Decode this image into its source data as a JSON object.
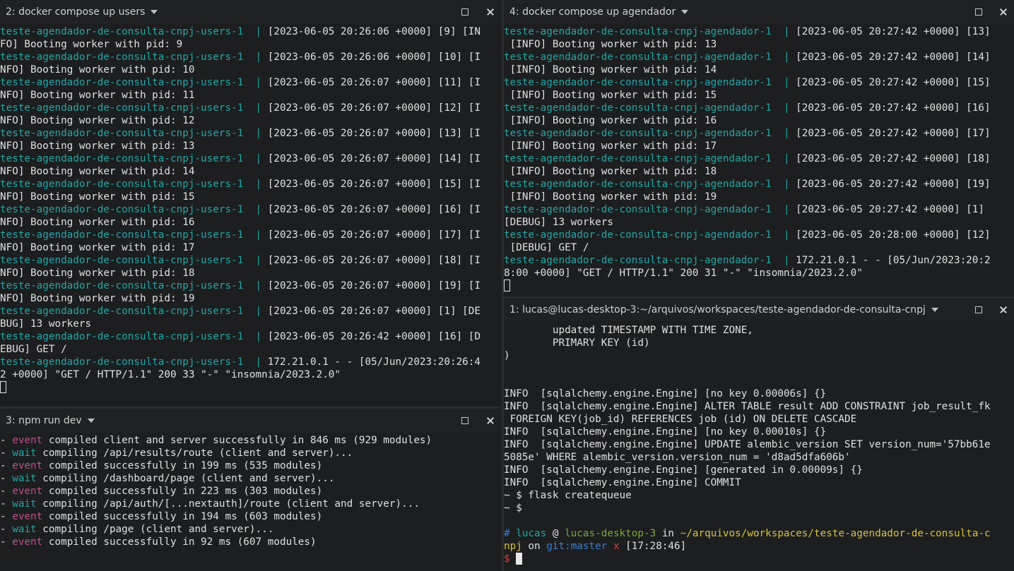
{
  "pane_users": {
    "title": "2: docker compose up users",
    "lines": [
      [
        {
          "t": "teste-agendador-de-consulta-cnpj-users-1  ",
          "c": "teal"
        },
        {
          "t": "| ",
          "c": "teal"
        },
        {
          "t": "[2023-06-05 20:26:06 +0000] [9] [IN",
          "c": ""
        }
      ],
      [
        {
          "t": "FO] Booting worker with pid: 9",
          "c": ""
        }
      ],
      [
        {
          "t": "teste-agendador-de-consulta-cnpj-users-1  ",
          "c": "teal"
        },
        {
          "t": "| ",
          "c": "teal"
        },
        {
          "t": "[2023-06-05 20:26:06 +0000] [10] [I",
          "c": ""
        }
      ],
      [
        {
          "t": "NFO] Booting worker with pid: 10",
          "c": ""
        }
      ],
      [
        {
          "t": "teste-agendador-de-consulta-cnpj-users-1  ",
          "c": "teal"
        },
        {
          "t": "| ",
          "c": "teal"
        },
        {
          "t": "[2023-06-05 20:26:07 +0000] [11] [I",
          "c": ""
        }
      ],
      [
        {
          "t": "NFO] Booting worker with pid: 11",
          "c": ""
        }
      ],
      [
        {
          "t": "teste-agendador-de-consulta-cnpj-users-1  ",
          "c": "teal"
        },
        {
          "t": "| ",
          "c": "teal"
        },
        {
          "t": "[2023-06-05 20:26:07 +0000] [12] [I",
          "c": ""
        }
      ],
      [
        {
          "t": "NFO] Booting worker with pid: 12",
          "c": ""
        }
      ],
      [
        {
          "t": "teste-agendador-de-consulta-cnpj-users-1  ",
          "c": "teal"
        },
        {
          "t": "| ",
          "c": "teal"
        },
        {
          "t": "[2023-06-05 20:26:07 +0000] [13] [I",
          "c": ""
        }
      ],
      [
        {
          "t": "NFO] Booting worker with pid: 13",
          "c": ""
        }
      ],
      [
        {
          "t": "teste-agendador-de-consulta-cnpj-users-1  ",
          "c": "teal"
        },
        {
          "t": "| ",
          "c": "teal"
        },
        {
          "t": "[2023-06-05 20:26:07 +0000] [14] [I",
          "c": ""
        }
      ],
      [
        {
          "t": "NFO] Booting worker with pid: 14",
          "c": ""
        }
      ],
      [
        {
          "t": "teste-agendador-de-consulta-cnpj-users-1  ",
          "c": "teal"
        },
        {
          "t": "| ",
          "c": "teal"
        },
        {
          "t": "[2023-06-05 20:26:07 +0000] [15] [I",
          "c": ""
        }
      ],
      [
        {
          "t": "NFO] Booting worker with pid: 15",
          "c": ""
        }
      ],
      [
        {
          "t": "teste-agendador-de-consulta-cnpj-users-1  ",
          "c": "teal"
        },
        {
          "t": "| ",
          "c": "teal"
        },
        {
          "t": "[2023-06-05 20:26:07 +0000] [16] [I",
          "c": ""
        }
      ],
      [
        {
          "t": "NFO] Booting worker with pid: 16",
          "c": ""
        }
      ],
      [
        {
          "t": "teste-agendador-de-consulta-cnpj-users-1  ",
          "c": "teal"
        },
        {
          "t": "| ",
          "c": "teal"
        },
        {
          "t": "[2023-06-05 20:26:07 +0000] [17] [I",
          "c": ""
        }
      ],
      [
        {
          "t": "NFO] Booting worker with pid: 17",
          "c": ""
        }
      ],
      [
        {
          "t": "teste-agendador-de-consulta-cnpj-users-1  ",
          "c": "teal"
        },
        {
          "t": "| ",
          "c": "teal"
        },
        {
          "t": "[2023-06-05 20:26:07 +0000] [18] [I",
          "c": ""
        }
      ],
      [
        {
          "t": "NFO] Booting worker with pid: 18",
          "c": ""
        }
      ],
      [
        {
          "t": "teste-agendador-de-consulta-cnpj-users-1  ",
          "c": "teal"
        },
        {
          "t": "| ",
          "c": "teal"
        },
        {
          "t": "[2023-06-05 20:26:07 +0000] [19] [I",
          "c": ""
        }
      ],
      [
        {
          "t": "NFO] Booting worker with pid: 19",
          "c": ""
        }
      ],
      [
        {
          "t": "teste-agendador-de-consulta-cnpj-users-1  ",
          "c": "teal"
        },
        {
          "t": "| ",
          "c": "teal"
        },
        {
          "t": "[2023-06-05 20:26:07 +0000] [1] [DE",
          "c": ""
        }
      ],
      [
        {
          "t": "BUG] 13 workers",
          "c": ""
        }
      ],
      [
        {
          "t": "teste-agendador-de-consulta-cnpj-users-1  ",
          "c": "teal"
        },
        {
          "t": "| ",
          "c": "teal"
        },
        {
          "t": "[2023-06-05 20:26:42 +0000] [16] [D",
          "c": ""
        }
      ],
      [
        {
          "t": "EBUG] GET /",
          "c": ""
        }
      ],
      [
        {
          "t": "teste-agendador-de-consulta-cnpj-users-1  ",
          "c": "teal"
        },
        {
          "t": "| ",
          "c": "teal"
        },
        {
          "t": "172.21.0.1 - - [05/Jun/2023:20:26:4",
          "c": ""
        }
      ],
      [
        {
          "t": "2 +0000] \"GET / HTTP/1.1\" 200 33 \"-\" \"insomnia/2023.2.0\"",
          "c": ""
        }
      ]
    ]
  },
  "pane_npm": {
    "title": "3: npm run dev",
    "lines": [
      [
        {
          "t": "- ",
          "c": ""
        },
        {
          "t": "event",
          "c": "pink"
        },
        {
          "t": " compiled client and server successfully in 846 ms (929 modules)",
          "c": ""
        }
      ],
      [
        {
          "t": "- ",
          "c": ""
        },
        {
          "t": "wait",
          "c": "teal"
        },
        {
          "t": " compiling /api/results/route (client and server)...",
          "c": ""
        }
      ],
      [
        {
          "t": "- ",
          "c": ""
        },
        {
          "t": "event",
          "c": "pink"
        },
        {
          "t": " compiled successfully in 199 ms (535 modules)",
          "c": ""
        }
      ],
      [
        {
          "t": "- ",
          "c": ""
        },
        {
          "t": "wait",
          "c": "teal"
        },
        {
          "t": " compiling /dashboard/page (client and server)...",
          "c": ""
        }
      ],
      [
        {
          "t": "- ",
          "c": ""
        },
        {
          "t": "event",
          "c": "pink"
        },
        {
          "t": " compiled successfully in 223 ms (303 modules)",
          "c": ""
        }
      ],
      [
        {
          "t": "- ",
          "c": ""
        },
        {
          "t": "wait",
          "c": "teal"
        },
        {
          "t": " compiling /api/auth/[...nextauth]/route (client and server)...",
          "c": ""
        }
      ],
      [
        {
          "t": "- ",
          "c": ""
        },
        {
          "t": "event",
          "c": "pink"
        },
        {
          "t": " compiled successfully in 194 ms (603 modules)",
          "c": ""
        }
      ],
      [
        {
          "t": "- ",
          "c": ""
        },
        {
          "t": "wait",
          "c": "teal"
        },
        {
          "t": " compiling /page (client and server)...",
          "c": ""
        }
      ],
      [
        {
          "t": "- ",
          "c": ""
        },
        {
          "t": "event",
          "c": "pink"
        },
        {
          "t": " compiled successfully in 92 ms (607 modules)",
          "c": ""
        }
      ]
    ]
  },
  "pane_agendador": {
    "title": "4: docker compose up agendador",
    "lines": [
      [
        {
          "t": "teste-agendador-de-consulta-cnpj-agendador-1  ",
          "c": "teal"
        },
        {
          "t": "| ",
          "c": "teal"
        },
        {
          "t": "[2023-06-05 20:27:42 +0000] [13]",
          "c": ""
        }
      ],
      [
        {
          "t": " [INFO] Booting worker with pid: 13",
          "c": ""
        }
      ],
      [
        {
          "t": "teste-agendador-de-consulta-cnpj-agendador-1  ",
          "c": "teal"
        },
        {
          "t": "| ",
          "c": "teal"
        },
        {
          "t": "[2023-06-05 20:27:42 +0000] [14]",
          "c": ""
        }
      ],
      [
        {
          "t": " [INFO] Booting worker with pid: 14",
          "c": ""
        }
      ],
      [
        {
          "t": "teste-agendador-de-consulta-cnpj-agendador-1  ",
          "c": "teal"
        },
        {
          "t": "| ",
          "c": "teal"
        },
        {
          "t": "[2023-06-05 20:27:42 +0000] [15]",
          "c": ""
        }
      ],
      [
        {
          "t": " [INFO] Booting worker with pid: 15",
          "c": ""
        }
      ],
      [
        {
          "t": "teste-agendador-de-consulta-cnpj-agendador-1  ",
          "c": "teal"
        },
        {
          "t": "| ",
          "c": "teal"
        },
        {
          "t": "[2023-06-05 20:27:42 +0000] [16]",
          "c": ""
        }
      ],
      [
        {
          "t": " [INFO] Booting worker with pid: 16",
          "c": ""
        }
      ],
      [
        {
          "t": "teste-agendador-de-consulta-cnpj-agendador-1  ",
          "c": "teal"
        },
        {
          "t": "| ",
          "c": "teal"
        },
        {
          "t": "[2023-06-05 20:27:42 +0000] [17]",
          "c": ""
        }
      ],
      [
        {
          "t": " [INFO] Booting worker with pid: 17",
          "c": ""
        }
      ],
      [
        {
          "t": "teste-agendador-de-consulta-cnpj-agendador-1  ",
          "c": "teal"
        },
        {
          "t": "| ",
          "c": "teal"
        },
        {
          "t": "[2023-06-05 20:27:42 +0000] [18]",
          "c": ""
        }
      ],
      [
        {
          "t": " [INFO] Booting worker with pid: 18",
          "c": ""
        }
      ],
      [
        {
          "t": "teste-agendador-de-consulta-cnpj-agendador-1  ",
          "c": "teal"
        },
        {
          "t": "| ",
          "c": "teal"
        },
        {
          "t": "[2023-06-05 20:27:42 +0000] [19]",
          "c": ""
        }
      ],
      [
        {
          "t": " [INFO] Booting worker with pid: 19",
          "c": ""
        }
      ],
      [
        {
          "t": "teste-agendador-de-consulta-cnpj-agendador-1  ",
          "c": "teal"
        },
        {
          "t": "| ",
          "c": "teal"
        },
        {
          "t": "[2023-06-05 20:27:42 +0000] [1]",
          "c": ""
        }
      ],
      [
        {
          "t": "[DEBUG] 13 workers",
          "c": ""
        }
      ],
      [
        {
          "t": "teste-agendador-de-consulta-cnpj-agendador-1  ",
          "c": "teal"
        },
        {
          "t": "| ",
          "c": "teal"
        },
        {
          "t": "[2023-06-05 20:28:00 +0000] [12]",
          "c": ""
        }
      ],
      [
        {
          "t": " [DEBUG] GET /",
          "c": ""
        }
      ],
      [
        {
          "t": "teste-agendador-de-consulta-cnpj-agendador-1  ",
          "c": "teal"
        },
        {
          "t": "| ",
          "c": "teal"
        },
        {
          "t": "172.21.0.1 - - [05/Jun/2023:20:2",
          "c": ""
        }
      ],
      [
        {
          "t": "8:00 +0000] \"GET / HTTP/1.1\" 200 31 \"-\" \"insomnia/2023.2.0\"",
          "c": ""
        }
      ]
    ]
  },
  "pane_shell": {
    "title": "1: lucas@lucas-desktop-3:~/arquivos/workspaces/teste-agendador-de-consulta-cnpj",
    "lines": [
      [
        {
          "t": "        updated TIMESTAMP WITH TIME ZONE,",
          "c": ""
        }
      ],
      [
        {
          "t": "        PRIMARY KEY (id)",
          "c": ""
        }
      ],
      [
        {
          "t": ")",
          "c": ""
        }
      ],
      [
        {
          "t": "",
          "c": ""
        }
      ],
      [
        {
          "t": "",
          "c": ""
        }
      ],
      [
        {
          "t": "INFO  [sqlalchemy.engine.Engine] [no key 0.00006s] {}",
          "c": ""
        }
      ],
      [
        {
          "t": "INFO  [sqlalchemy.engine.Engine] ALTER TABLE result ADD CONSTRAINT job_result_fk",
          "c": ""
        }
      ],
      [
        {
          "t": " FOREIGN KEY(job_id) REFERENCES job (id) ON DELETE CASCADE",
          "c": ""
        }
      ],
      [
        {
          "t": "INFO  [sqlalchemy.engine.Engine] [no key 0.00010s] {}",
          "c": ""
        }
      ],
      [
        {
          "t": "INFO  [sqlalchemy.engine.Engine] UPDATE alembic_version SET version_num='57bb61e",
          "c": ""
        }
      ],
      [
        {
          "t": "5085e' WHERE alembic_version.version_num = 'd8ad5dfa606b'",
          "c": ""
        }
      ],
      [
        {
          "t": "INFO  [sqlalchemy.engine.Engine] [generated in 0.00009s] {}",
          "c": ""
        }
      ],
      [
        {
          "t": "INFO  [sqlalchemy.engine.Engine] COMMIT",
          "c": ""
        }
      ],
      [
        {
          "t": "~ $ flask createqueue",
          "c": ""
        }
      ],
      [
        {
          "t": "~ $",
          "c": ""
        }
      ],
      [
        {
          "t": "",
          "c": ""
        }
      ],
      [
        {
          "t": "# ",
          "c": "blue"
        },
        {
          "t": "lucas",
          "c": "teal"
        },
        {
          "t": " @ ",
          "c": ""
        },
        {
          "t": "lucas-desktop-3",
          "c": "green"
        },
        {
          "t": " in ",
          "c": ""
        },
        {
          "t": "~/arquivos/workspaces/teste-agendador-de-consulta-c",
          "c": "yellow"
        }
      ],
      [
        {
          "t": "npj",
          "c": "yellow"
        },
        {
          "t": " on ",
          "c": ""
        },
        {
          "t": "git:master",
          "c": "blue"
        },
        {
          "t": " x",
          "c": "red"
        },
        {
          "t": " [17:28:46]",
          "c": ""
        }
      ]
    ],
    "prompt_symbol": "$"
  }
}
